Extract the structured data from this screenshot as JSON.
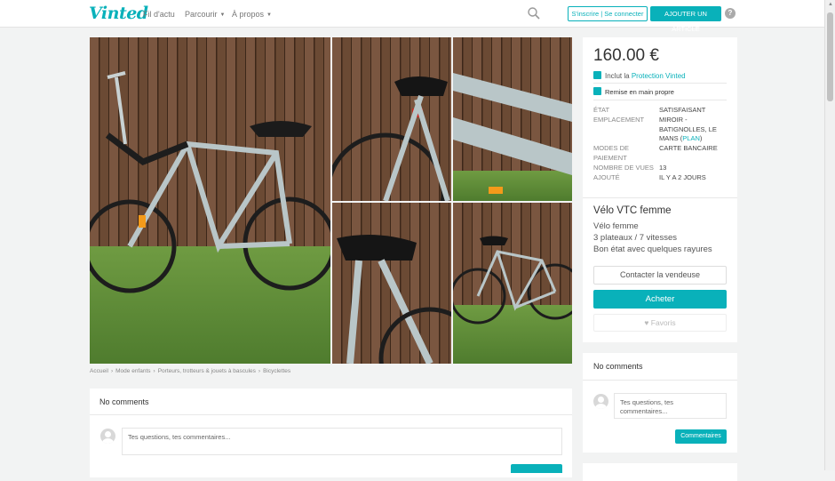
{
  "brand": {
    "logo": "Vinted",
    "accent": "#09b1ba"
  },
  "nav": {
    "feed": "Fil d'actu",
    "browse": "Parcourir",
    "about": "À propos"
  },
  "header": {
    "login": "S'inscrire | Se connecter",
    "sell": "AJOUTER UN ARTICLE",
    "help": "?"
  },
  "breadcrumb": [
    "Accueil",
    "Mode enfants",
    "Porteurs, trotteurs & jouets à bascules",
    "Bicyclettes"
  ],
  "item": {
    "price": "160.00 €",
    "protection_prefix": "Inclut la",
    "protection_link": "Protection Vinted",
    "handover": "Remise en main propre",
    "details": {
      "condition_label": "ÉTAT",
      "condition": "SATISFAISANT",
      "location_label": "EMPLACEMENT",
      "location": "MIROIR - BATIGNOLLES, LE MANS",
      "plan": "PLAN",
      "payment_label": "MODES DE PAIEMENT",
      "payment": "CARTE BANCAIRE",
      "views_label": "NOMBRE DE VUES",
      "views": "13",
      "added_label": "AJOUTÉ",
      "added": "IL Y A 2 JOURS"
    },
    "title": "Vélo VTC femme",
    "description": [
      "Vélo femme",
      "3 plateaux / 7 vitesses",
      "Bon état avec quelques rayures"
    ],
    "contact_button": "Contacter la vendeuse",
    "buy_button": "Acheter",
    "favorite_button": "Favoris"
  },
  "comments": {
    "heading": "No comments",
    "placeholder": "Tes questions, tes commentaires...",
    "side_heading": "No comments",
    "side_placeholder": "Tes questions, tes commentaires...",
    "side_button": "Commentaires"
  }
}
